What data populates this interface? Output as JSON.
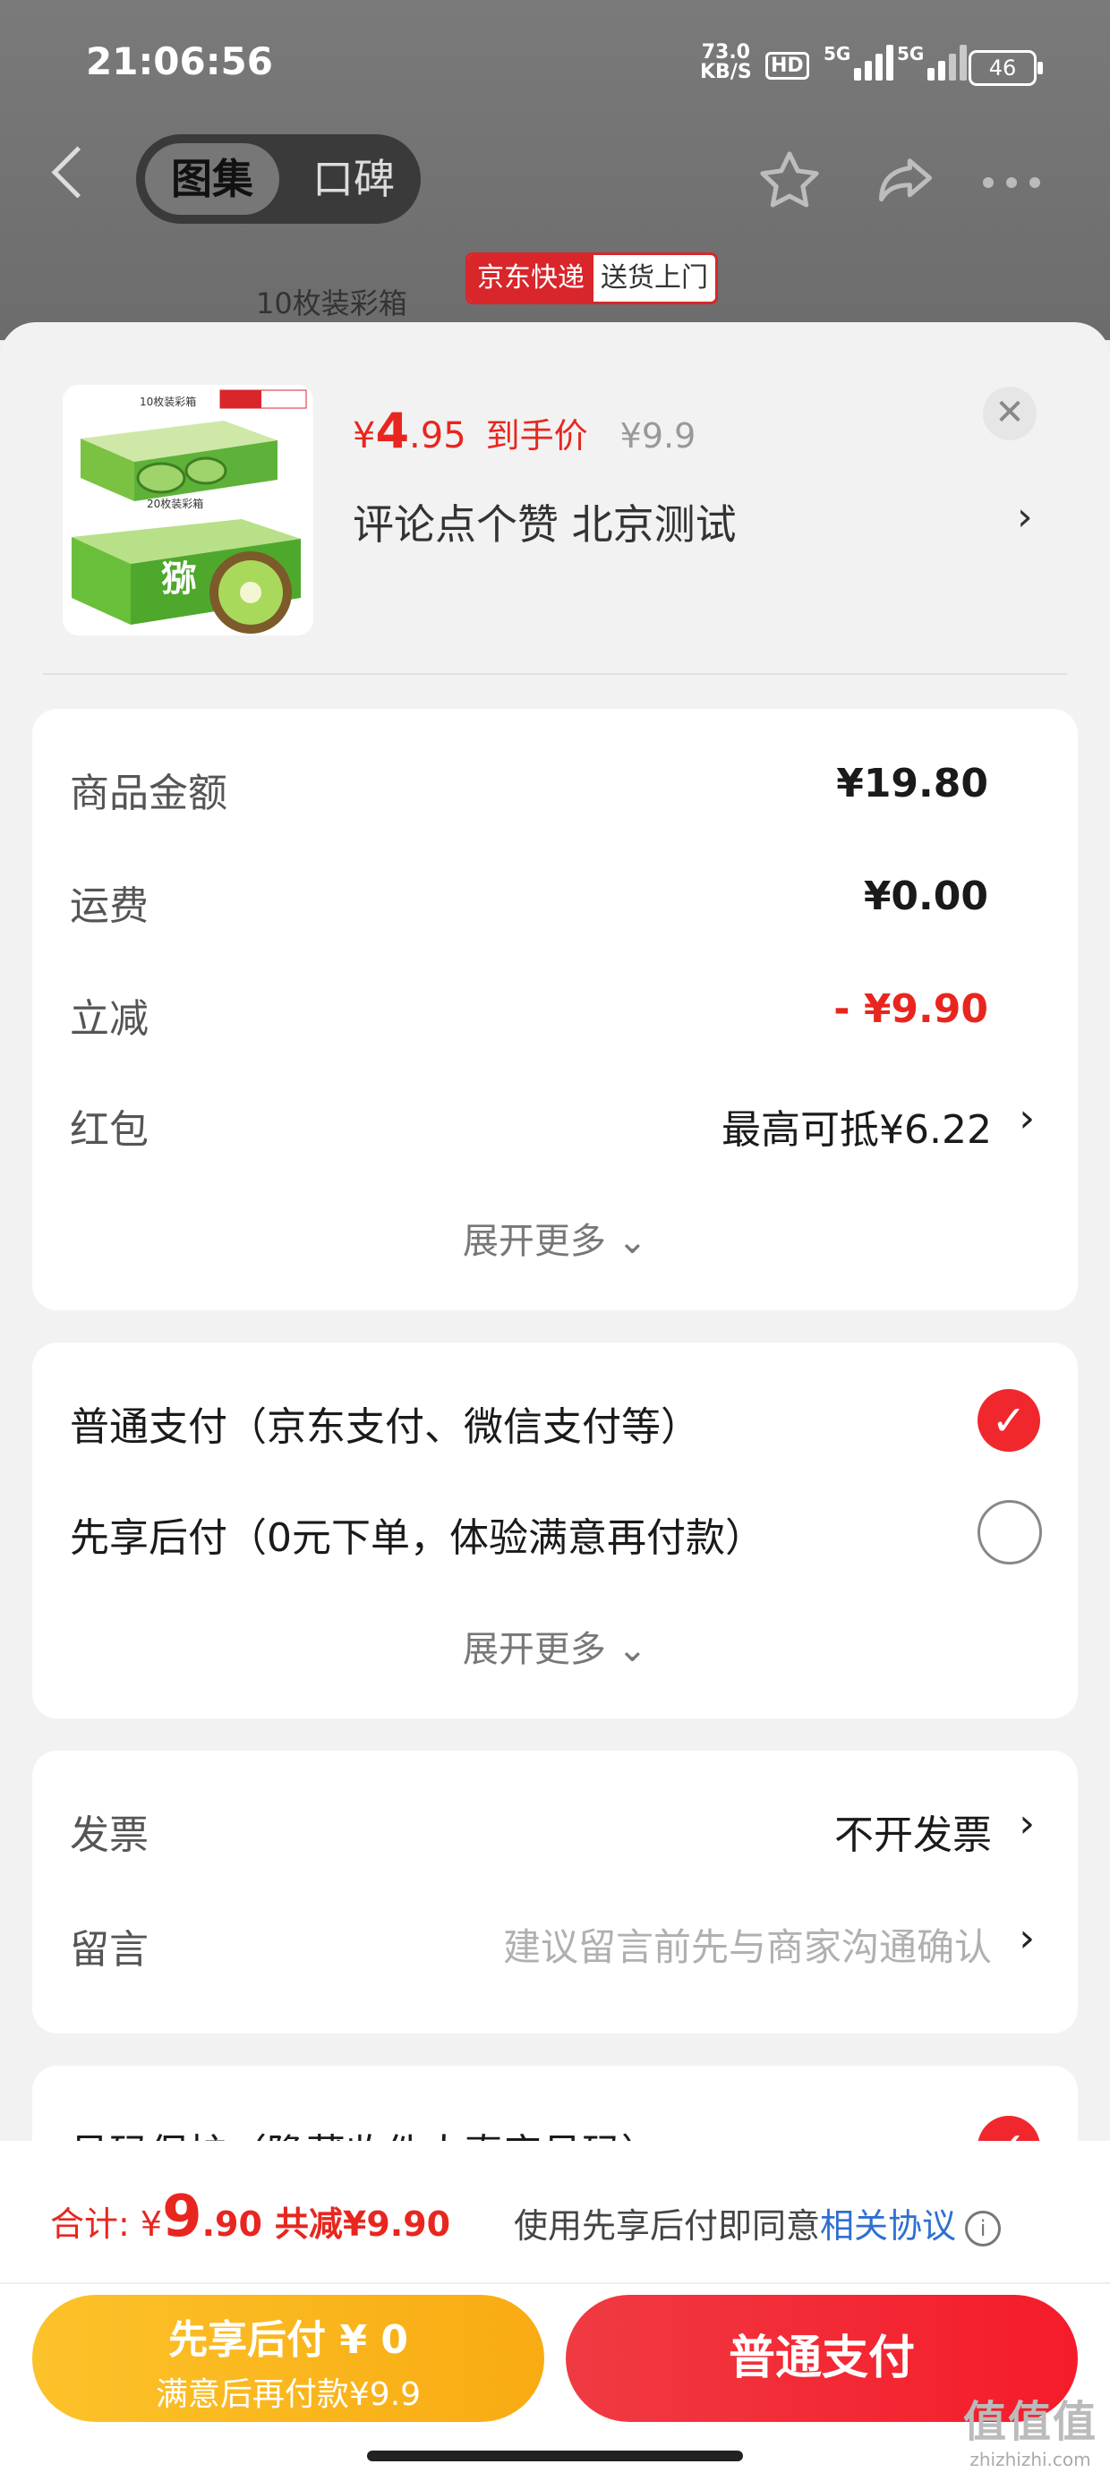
{
  "status_bar": {
    "time": "21:06:56",
    "net_speed_value": "73.0",
    "net_speed_unit": "KB/S",
    "hd_badge": "HD",
    "signal1": "5G",
    "signal2": "5G",
    "battery": "46"
  },
  "nav": {
    "tab_gallery": "图集",
    "tab_reviews": "口碑"
  },
  "product_banner": {
    "box_label": "10枚装彩箱",
    "jd_tag_left": "京东快递",
    "jd_tag_right": "送货上门"
  },
  "product": {
    "image_caption_top": "10枚装彩箱",
    "image_caption_bottom": "20枚装彩箱",
    "price_symbol": "¥",
    "price_int": "4",
    "price_dec": ".95",
    "price_label": "到手价",
    "original_price": "¥9.9",
    "spec": "评论点个赞  北京测试",
    "close_symbol": "✕"
  },
  "amount": {
    "rows": [
      {
        "label": "商品金额",
        "value": "¥19.80"
      },
      {
        "label": "运费",
        "value": "¥0.00"
      },
      {
        "label": "立减",
        "value": "- ¥9.90"
      },
      {
        "label": "红包",
        "value": "最高可抵¥6.22"
      }
    ],
    "expand": "展开更多 ⌄"
  },
  "payment": {
    "options": [
      {
        "label": "普通支付（京东支付、微信支付等）",
        "selected": true
      },
      {
        "label": "先享后付（0元下单，体验满意再付款）",
        "selected": false
      }
    ],
    "expand": "展开更多 ⌄"
  },
  "extras": {
    "invoice_label": "发票",
    "invoice_value": "不开发票",
    "message_label": "留言",
    "message_placeholder": "建议留言前先与商家沟通确认"
  },
  "privacy": {
    "label": "号码保护（隐藏收件人真实号码）"
  },
  "footer": {
    "total_label": "合计: ¥",
    "total_int": "9",
    "total_dec": ".90",
    "total_saving": "共减¥9.90",
    "agree_text": "使用先享后付即同意",
    "agree_link": "相关协议",
    "info_icon": "i",
    "btn_later_line1": "先享后付 ¥ 0",
    "btn_later_line2": "满意后再付款¥9.9",
    "btn_pay": "普通支付"
  },
  "watermark": {
    "logo": "值值值",
    "site": "zhizhizhi.com"
  },
  "colors": {
    "accent_red": "#e8261f",
    "pay_button": "#f51b2a",
    "later_button": "#f9ab12",
    "link_blue": "#2f6fd1"
  }
}
